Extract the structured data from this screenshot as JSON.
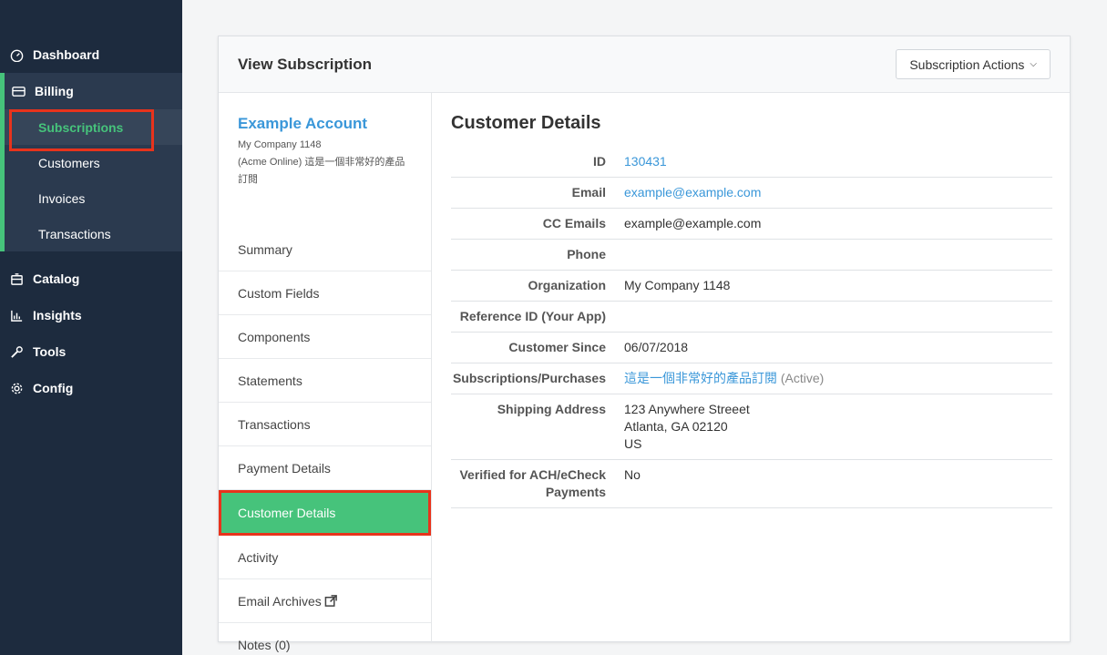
{
  "sidebar": {
    "dashboard": "Dashboard",
    "billing": "Billing",
    "billing_items": [
      "Subscriptions",
      "Customers",
      "Invoices",
      "Transactions"
    ],
    "catalog": "Catalog",
    "insights": "Insights",
    "tools": "Tools",
    "config": "Config"
  },
  "header": {
    "title": "View Subscription",
    "actions_label": "Subscription Actions"
  },
  "account": {
    "name": "Example Account",
    "company": "My Company 1148",
    "product": "(Acme Online) 這是一個非常好的產品訂閱"
  },
  "left_nav": [
    "Summary",
    "Custom Fields",
    "Components",
    "Statements",
    "Transactions",
    "Payment Details",
    "Customer Details",
    "Activity",
    "Email Archives",
    "Notes (0)"
  ],
  "details": {
    "title": "Customer Details",
    "id_label": "ID",
    "id_value": "130431",
    "email_label": "Email",
    "email_value": "example@example.com",
    "cc_label": "CC Emails",
    "cc_value": "example@example.com",
    "phone_label": "Phone",
    "phone_value": "",
    "org_label": "Organization",
    "org_value": "My Company 1148",
    "ref_label": "Reference ID (Your App)",
    "ref_value": "",
    "since_label": "Customer Since",
    "since_value": "06/07/2018",
    "subs_label": "Subscriptions/Purchases",
    "subs_link": "這是一個非常好的產品訂閱",
    "subs_status": "(Active)",
    "ship_label": "Shipping Address",
    "ship_line1": "123 Anywhere Streeet",
    "ship_line2": "Atlanta, GA 02120",
    "ship_line3": "US",
    "ach_label": "Verified for ACH/eCheck Payments",
    "ach_value": "No"
  },
  "colors": {
    "sidebar_bg": "#1d2b3e",
    "accent_green": "#46c37b",
    "link_blue": "#3a97d9",
    "highlight_red": "#e8331c"
  }
}
